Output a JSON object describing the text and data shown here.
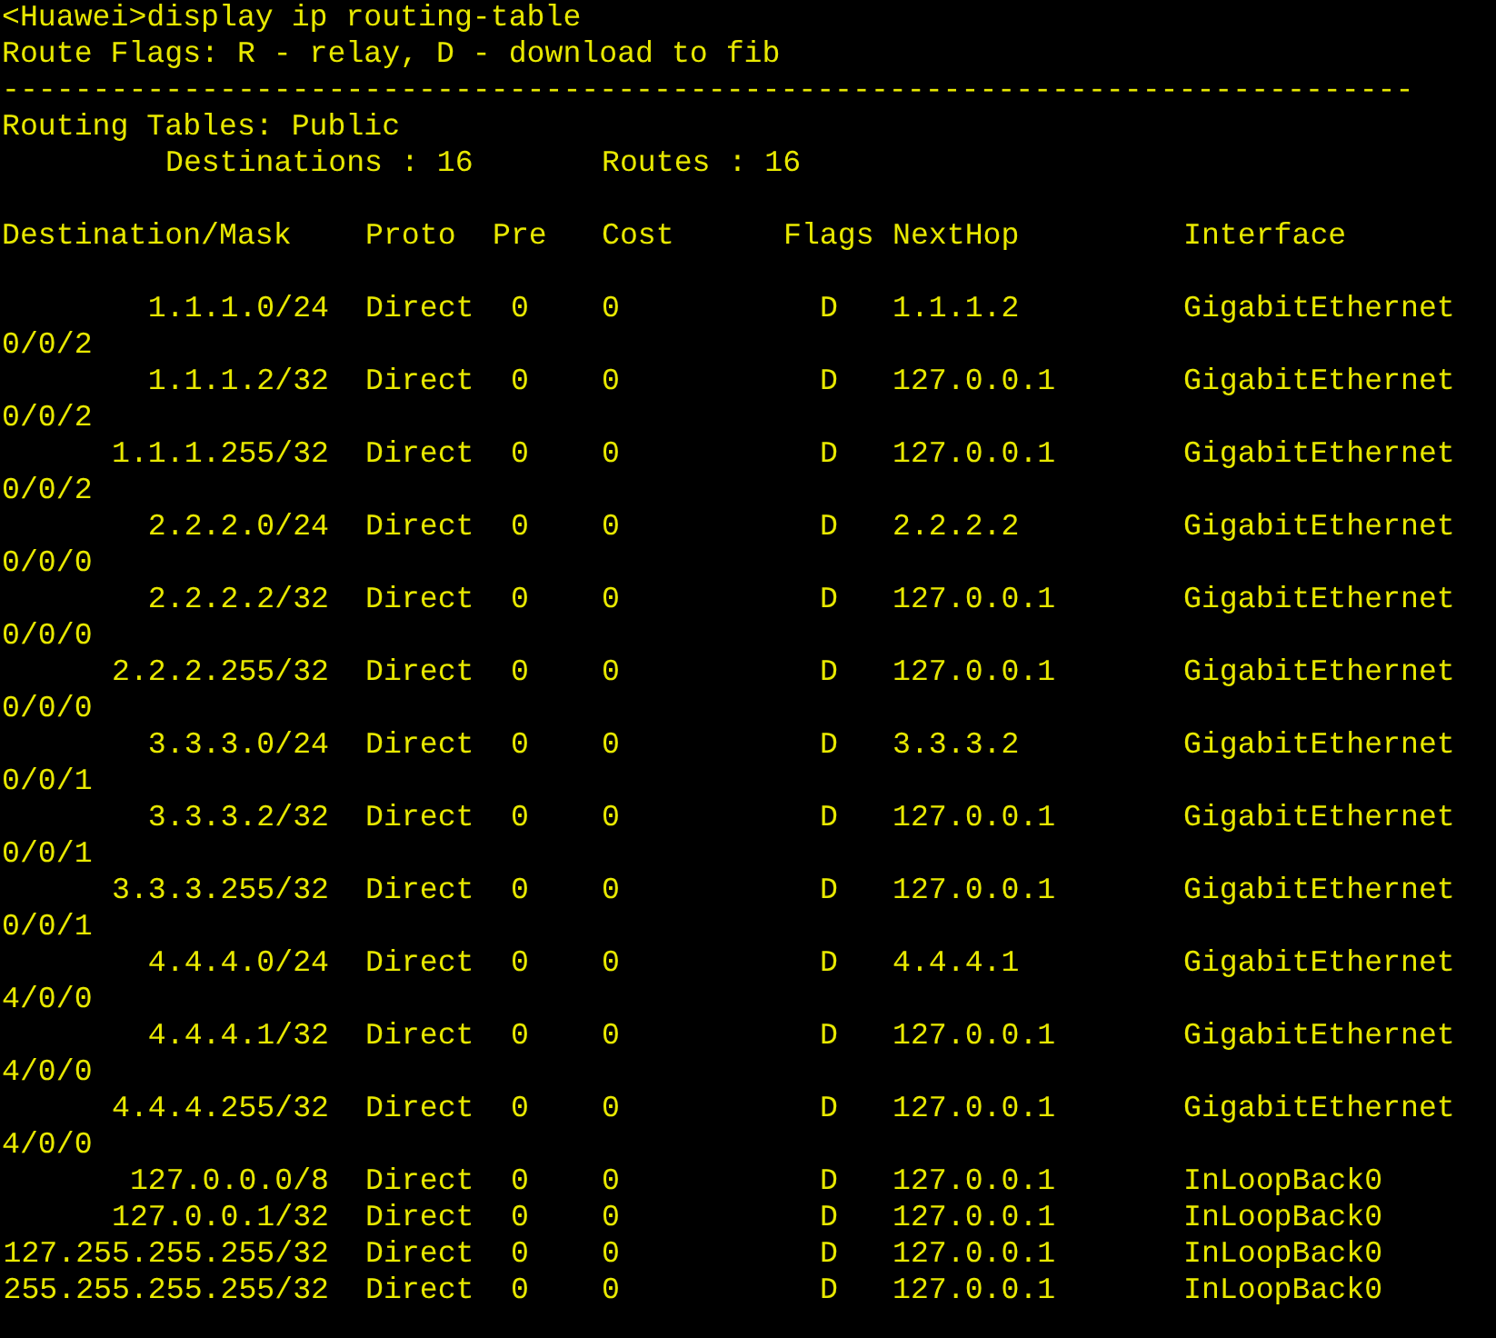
{
  "command_line": "<Huawei>display ip routing-table",
  "route_flags": "Route Flags: R - relay, D - download to fib",
  "separator": "------------------------------------------------------------------------------",
  "table_title": "Routing Tables: Public",
  "destinations": "Destinations : 16",
  "routes": "Routes : 16",
  "columns": [
    "Destination/Mask",
    "Proto",
    "Pre",
    "Cost",
    "Flags",
    "NextHop",
    "Interface"
  ],
  "rows": [
    {
      "destination": "1.1.1.0/24",
      "proto": "Direct",
      "pre": "0",
      "cost": "0",
      "flags": "D",
      "nexthop": "1.1.1.2",
      "interface": "GigabitEthernet",
      "interface_continued": "0/0/2"
    },
    {
      "destination": "1.1.1.2/32",
      "proto": "Direct",
      "pre": "0",
      "cost": "0",
      "flags": "D",
      "nexthop": "127.0.0.1",
      "interface": "GigabitEthernet",
      "interface_continued": "0/0/2"
    },
    {
      "destination": "1.1.1.255/32",
      "proto": "Direct",
      "pre": "0",
      "cost": "0",
      "flags": "D",
      "nexthop": "127.0.0.1",
      "interface": "GigabitEthernet",
      "interface_continued": "0/0/2"
    },
    {
      "destination": "2.2.2.0/24",
      "proto": "Direct",
      "pre": "0",
      "cost": "0",
      "flags": "D",
      "nexthop": "2.2.2.2",
      "interface": "GigabitEthernet",
      "interface_continued": "0/0/0"
    },
    {
      "destination": "2.2.2.2/32",
      "proto": "Direct",
      "pre": "0",
      "cost": "0",
      "flags": "D",
      "nexthop": "127.0.0.1",
      "interface": "GigabitEthernet",
      "interface_continued": "0/0/0"
    },
    {
      "destination": "2.2.2.255/32",
      "proto": "Direct",
      "pre": "0",
      "cost": "0",
      "flags": "D",
      "nexthop": "127.0.0.1",
      "interface": "GigabitEthernet",
      "interface_continued": "0/0/0"
    },
    {
      "destination": "3.3.3.0/24",
      "proto": "Direct",
      "pre": "0",
      "cost": "0",
      "flags": "D",
      "nexthop": "3.3.3.2",
      "interface": "GigabitEthernet",
      "interface_continued": "0/0/1"
    },
    {
      "destination": "3.3.3.2/32",
      "proto": "Direct",
      "pre": "0",
      "cost": "0",
      "flags": "D",
      "nexthop": "127.0.0.1",
      "interface": "GigabitEthernet",
      "interface_continued": "0/0/1"
    },
    {
      "destination": "3.3.3.255/32",
      "proto": "Direct",
      "pre": "0",
      "cost": "0",
      "flags": "D",
      "nexthop": "127.0.0.1",
      "interface": "GigabitEthernet",
      "interface_continued": "0/0/1"
    },
    {
      "destination": "4.4.4.0/24",
      "proto": "Direct",
      "pre": "0",
      "cost": "0",
      "flags": "D",
      "nexthop": "4.4.4.1",
      "interface": "GigabitEthernet",
      "interface_continued": "4/0/0"
    },
    {
      "destination": "4.4.4.1/32",
      "proto": "Direct",
      "pre": "0",
      "cost": "0",
      "flags": "D",
      "nexthop": "127.0.0.1",
      "interface": "GigabitEthernet",
      "interface_continued": "4/0/0"
    },
    {
      "destination": "4.4.4.255/32",
      "proto": "Direct",
      "pre": "0",
      "cost": "0",
      "flags": "D",
      "nexthop": "127.0.0.1",
      "interface": "GigabitEthernet",
      "interface_continued": "4/0/0"
    },
    {
      "destination": "127.0.0.0/8",
      "proto": "Direct",
      "pre": "0",
      "cost": "0",
      "flags": "D",
      "nexthop": "127.0.0.1",
      "interface": "InLoopBack0"
    },
    {
      "destination": "127.0.0.1/32",
      "proto": "Direct",
      "pre": "0",
      "cost": "0",
      "flags": "D",
      "nexthop": "127.0.0.1",
      "interface": "InLoopBack0"
    },
    {
      "destination": "127.255.255.255/32",
      "proto": "Direct",
      "pre": "0",
      "cost": "0",
      "flags": "D",
      "nexthop": "127.0.0.1",
      "interface": "InLoopBack0"
    },
    {
      "destination": "255.255.255.255/32",
      "proto": "Direct",
      "pre": "0",
      "cost": "0",
      "flags": "D",
      "nexthop": "127.0.0.1",
      "interface": "InLoopBack0"
    }
  ]
}
